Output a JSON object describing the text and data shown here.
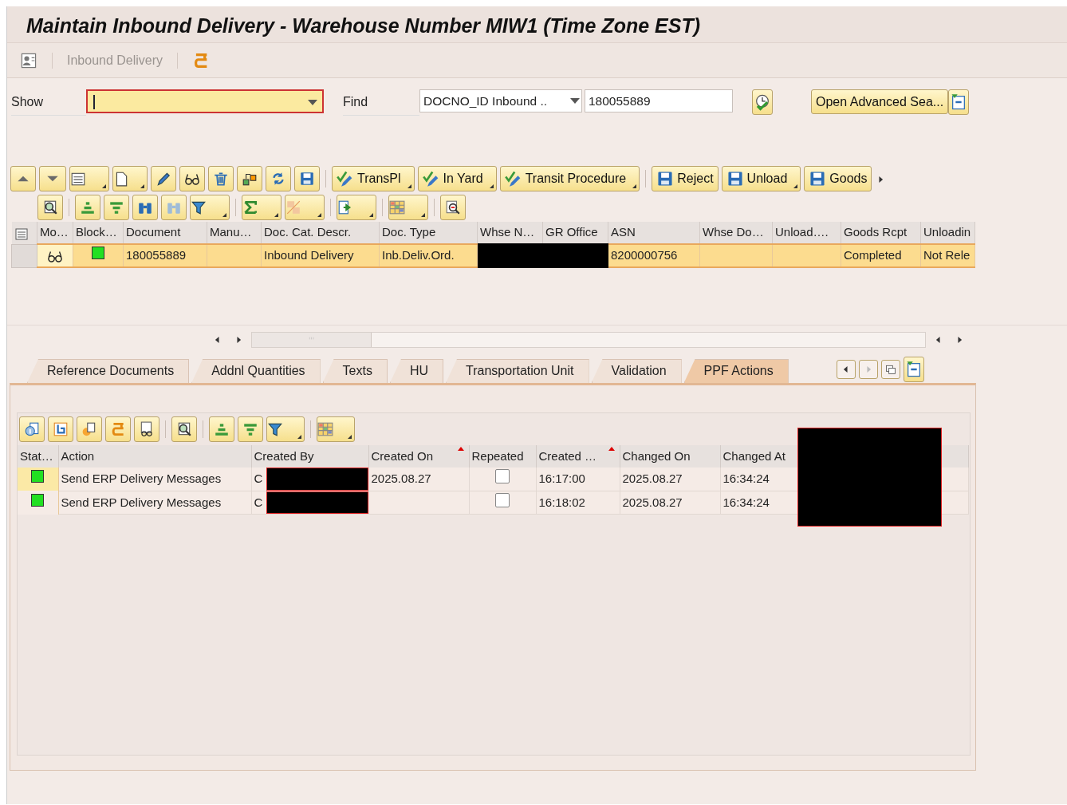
{
  "window": {
    "title": "Maintain Inbound Delivery - Warehouse Number MIW1 (Time Zone EST)"
  },
  "app_toolbar": {
    "label": "Inbound Delivery",
    "disabled": true
  },
  "search": {
    "show_label": "Show",
    "show_focused": true,
    "find_label": "Find",
    "find_field": "DOCNO_ID Inbound ..",
    "find_value": "180055889",
    "advanced_button": "Open Advanced Sea..."
  },
  "toolbar": [
    {
      "label": "TransPl",
      "kind": "check",
      "dropdown": true
    },
    {
      "label": "In Yard",
      "kind": "check",
      "dropdown": true
    },
    {
      "label": "Transit Procedure",
      "kind": "check",
      "dropdown": true
    },
    {
      "label": "Reject",
      "kind": "save",
      "dropdown": false
    },
    {
      "label": "Unload",
      "kind": "save",
      "dropdown": true
    },
    {
      "label": "Goods",
      "kind": "save",
      "dropdown": false
    }
  ],
  "results": {
    "columns": [
      "Mo…",
      "Block…",
      "Document",
      "Manu…",
      "Doc. Cat. Descr.",
      "Doc. Type",
      "Whse N…",
      "GR Office",
      "ASN",
      "Whse Do…",
      "Unload….",
      "Goods Rcpt",
      "Unloadin"
    ],
    "rows": [
      {
        "selected": true,
        "cells": [
          {
            "kind": "glasses"
          },
          {
            "kind": "status",
            "color": "#22e022"
          },
          {
            "kind": "text",
            "text": "180055889"
          },
          {
            "kind": "empty"
          },
          {
            "kind": "text",
            "text": "Inbound Delivery"
          },
          {
            "kind": "text",
            "text": "Inb.Deliv.Ord."
          },
          {
            "kind": "redacted"
          },
          {
            "kind": "redacted"
          },
          {
            "kind": "text",
            "text": "8200000756"
          },
          {
            "kind": "empty"
          },
          {
            "kind": "empty"
          },
          {
            "kind": "text",
            "text": "Completed"
          },
          {
            "kind": "text",
            "text": "Not Rele"
          }
        ]
      }
    ]
  },
  "tabs": [
    {
      "label": "Reference Documents",
      "selected": false
    },
    {
      "label": "Addnl Quantities",
      "selected": false
    },
    {
      "label": "Texts",
      "selected": false
    },
    {
      "label": "HU",
      "selected": false
    },
    {
      "label": "Transportation Unit",
      "selected": false
    },
    {
      "label": "Validation",
      "selected": false
    },
    {
      "label": "PPF Actions",
      "selected": true
    }
  ],
  "actions": {
    "redacted_overlay": true,
    "columns": [
      {
        "label": "Stat…",
        "sorted": false
      },
      {
        "label": "Action",
        "sorted": false
      },
      {
        "label": "Created By",
        "sorted": false
      },
      {
        "label": "Created On",
        "sorted": true
      },
      {
        "label": "Repeated",
        "sorted": false
      },
      {
        "label": "Created …",
        "sorted": true
      },
      {
        "label": "Changed On",
        "sorted": false
      },
      {
        "label": "Changed At",
        "sorted": false
      }
    ],
    "rows": [
      {
        "selected": true,
        "color": "#22e022",
        "action": "Send ERP Delivery Messages",
        "created_by": "C",
        "created_by_redacted": true,
        "created_on": "2025.08.27",
        "repeated": false,
        "created_at": "16:17:00",
        "changed_on": "2025.08.27",
        "changed_at": "16:34:24"
      },
      {
        "selected": false,
        "color": "#22e022",
        "action": "Send ERP Delivery Messages",
        "created_by": "C",
        "created_by_redacted": true,
        "repeated": false,
        "created_at": "16:18:02",
        "changed_on": "2025.08.27",
        "changed_at": "16:34:24"
      }
    ]
  }
}
